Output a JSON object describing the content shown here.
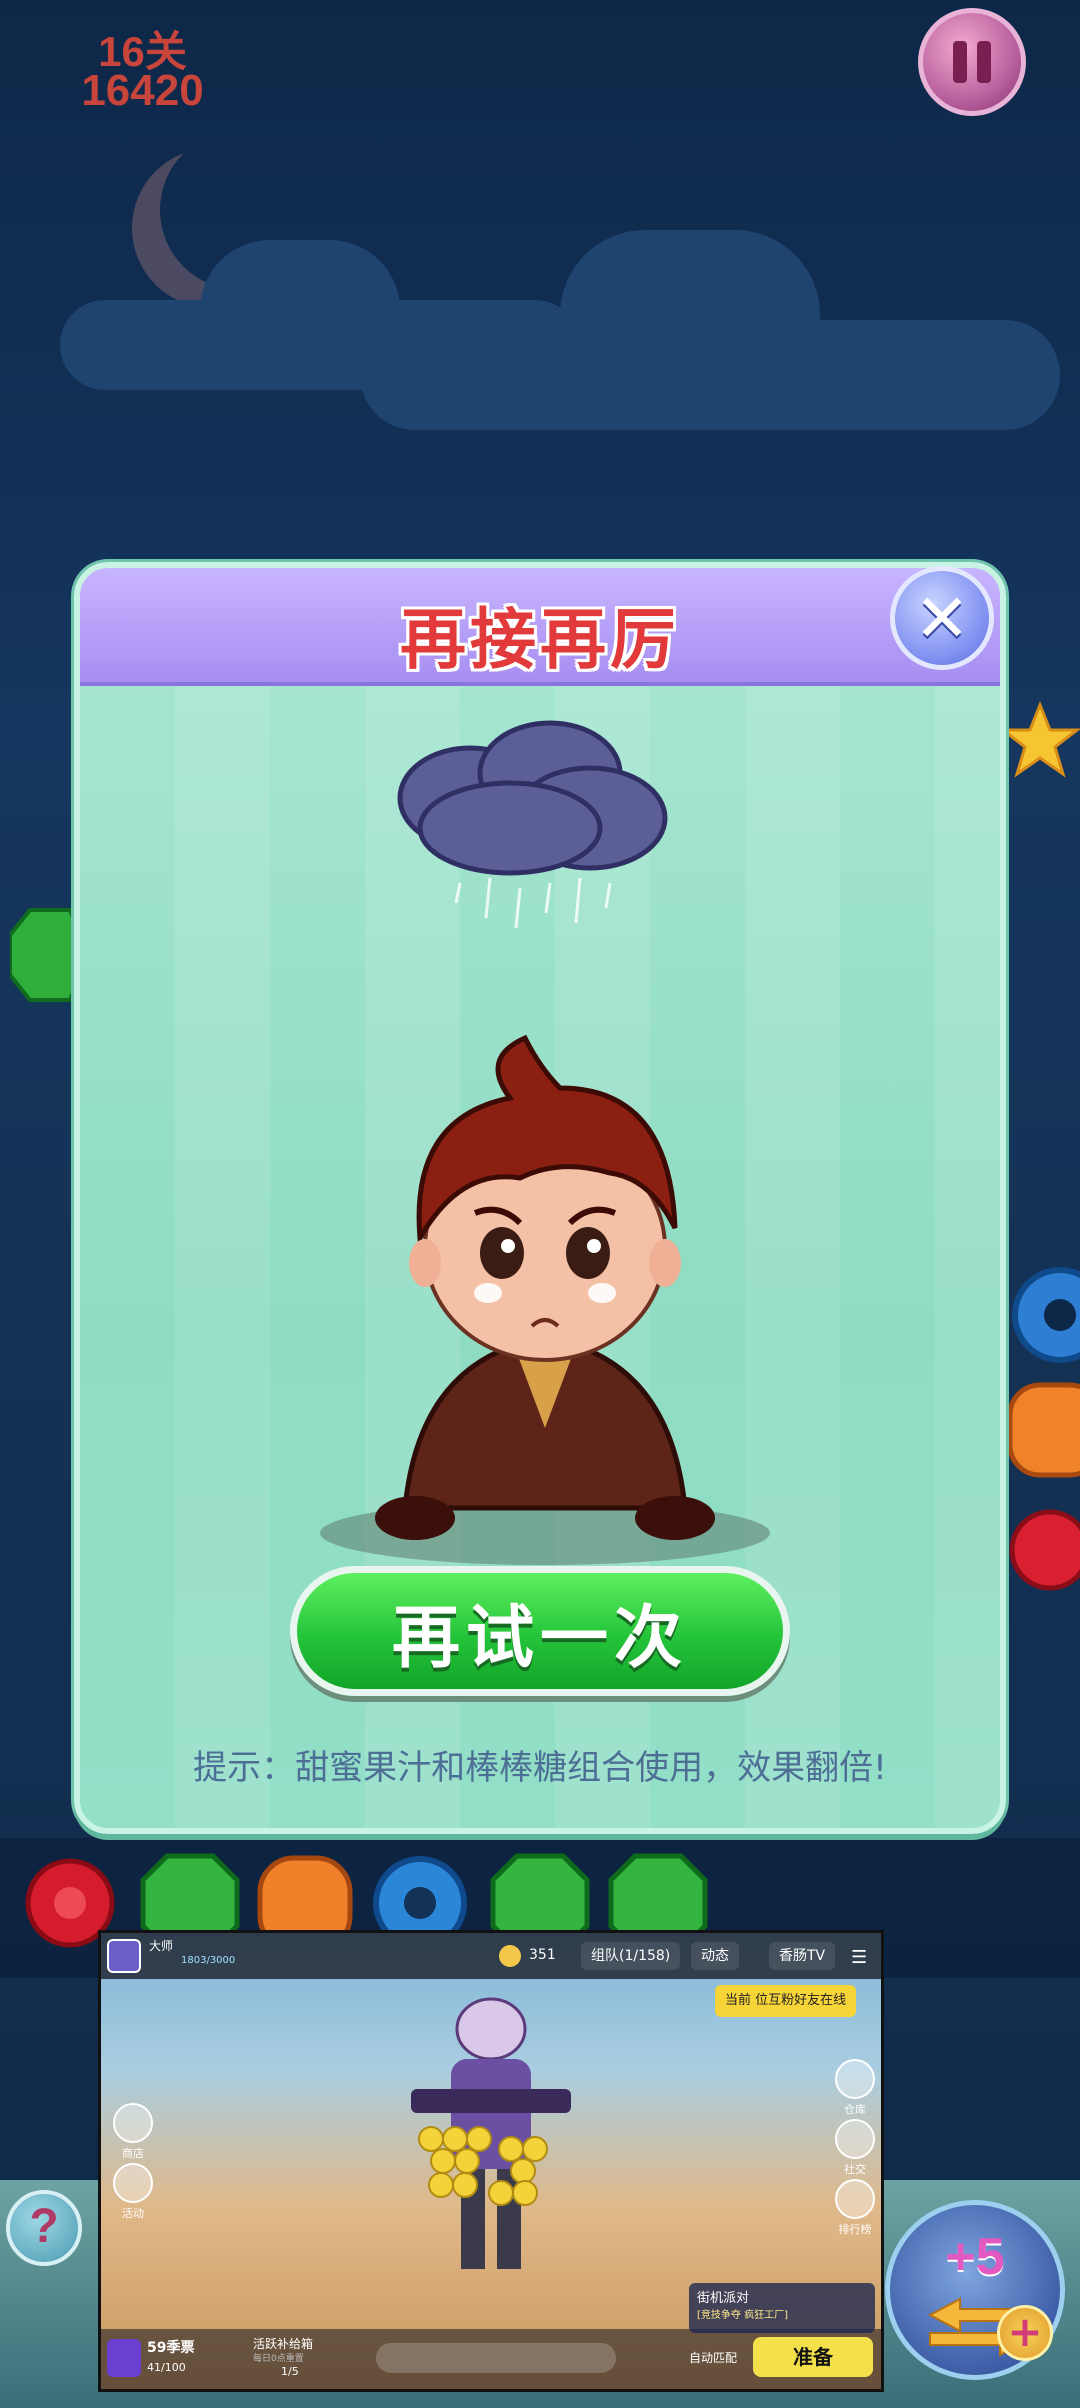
{
  "hud": {
    "level": "16关",
    "score": "16420"
  },
  "dialog": {
    "title": "再接再厉",
    "retry_label": "再试一次",
    "hint": "提示：甜蜜果汁和棒棒糖组合使用，效果翻倍!"
  },
  "pip": {
    "player_name": "大师",
    "player_exp": "1803/3000",
    "coins": "351",
    "team_tab": "组队(1/158)",
    "news_tab": "动态",
    "tv_tab": "香肠TV",
    "invite_banner": "当前 位互粉好友在线",
    "side_left": [
      "商店",
      "活动"
    ],
    "side_right": [
      "仓库",
      "社交",
      "排行榜"
    ],
    "season_level": "59季票",
    "season_progress": "41/100",
    "reward_title": "活跃补给箱",
    "reward_sub": "每日0点重置",
    "reward_progress": "1/5",
    "event_title": "街机派对",
    "event_sub": "[竞技争夺 疯狂工厂]",
    "auto_match": "自动匹配",
    "ready_label": "准备"
  },
  "bottom": {
    "help_label": "?",
    "boost_label": "+5",
    "boost_plus": "+"
  },
  "colors": {
    "dialog_bg": "#9fe2cb",
    "header_bg": "#b7a3f7",
    "title_red": "#e23a3a",
    "retry_green": "#24c43a",
    "hint_blue": "#4d6f96"
  }
}
